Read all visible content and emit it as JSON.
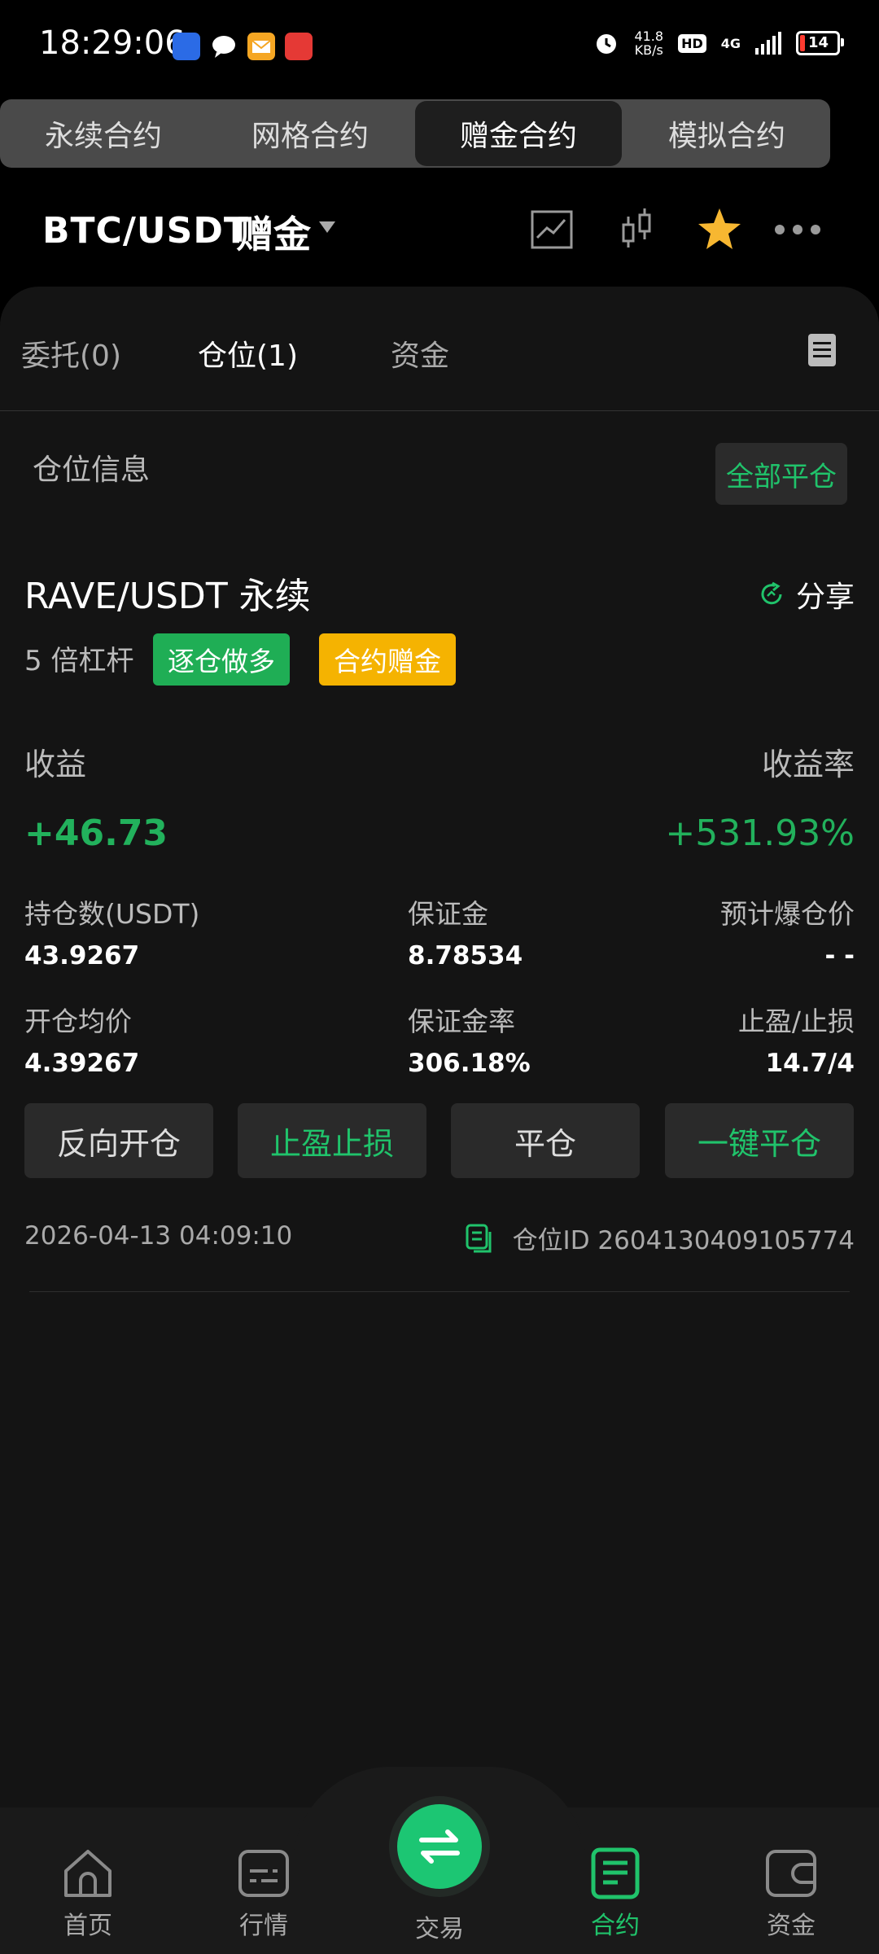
{
  "status": {
    "time": "18:29:06",
    "net_speed": "41.8",
    "net_unit": "KB/s",
    "hd": "HD",
    "network": "4G",
    "battery": "14"
  },
  "contract_tabs": [
    {
      "label": "永续合约"
    },
    {
      "label": "网格合约"
    },
    {
      "label": "赠金合约"
    },
    {
      "label": "模拟合约"
    }
  ],
  "header": {
    "pair": "BTC/USDT",
    "suffix": "赠金"
  },
  "panel_tabs": {
    "orders": "委托(0)",
    "positions": "仓位(1)",
    "funds": "资金"
  },
  "position": {
    "section_title": "仓位信息",
    "close_all": "全部平仓",
    "symbol": "RAVE/USDT 永续",
    "share": "分享",
    "leverage": "5 倍杠杆",
    "tag_side": "逐仓做多",
    "tag_bonus": "合约赠金",
    "pnl_label": "收益",
    "pnl": "+46.73",
    "roe_label": "收益率",
    "roe": "+531.93%",
    "size_label": "持仓数(USDT)",
    "size": "43.9267",
    "margin_label": "保证金",
    "margin": "8.78534",
    "liq_label": "预计爆仓价",
    "liq": "- -",
    "entry_label": "开仓均价",
    "entry": "4.39267",
    "margin_rate_label": "保证金率",
    "margin_rate": "306.18%",
    "tpsl_label": "止盈/止损",
    "tpsl": "14.7/4",
    "btn_reverse": "反向开仓",
    "btn_tpsl": "止盈止损",
    "btn_close": "平仓",
    "btn_close_one": "一键平仓",
    "timestamp": "2026-04-13 04:09:10",
    "position_id": "仓位ID 2604130409105774"
  },
  "nav": {
    "home": "首页",
    "market": "行情",
    "trade": "交易",
    "contract": "合约",
    "assets": "资金"
  },
  "colors": {
    "green": "#20c36b",
    "gold": "#f5b301",
    "bg": "#141414"
  }
}
